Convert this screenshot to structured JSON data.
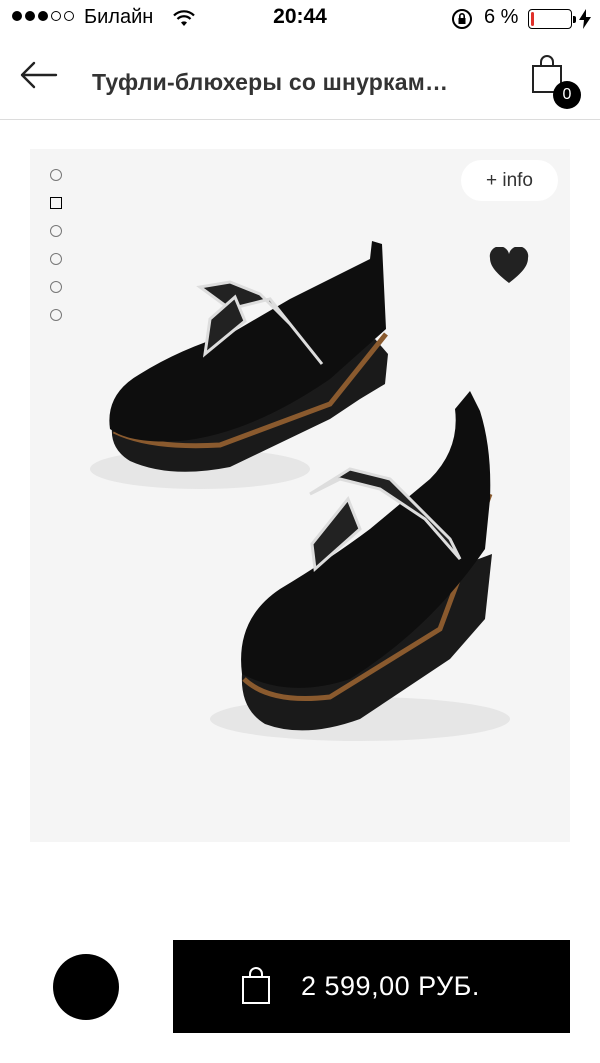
{
  "status_bar": {
    "carrier": "Билайн",
    "time": "20:44",
    "battery_percent": "6 %",
    "battery_level": 0.06,
    "signal_dots_filled": 3,
    "signal_dots_total": 5
  },
  "header": {
    "title": "Туфли-блюхеры со шнуркам…",
    "cart_count": "0"
  },
  "gallery": {
    "info_label": "+ info",
    "thumbnail_count": 6,
    "active_index": 1
  },
  "purchase": {
    "price": "2 599,00  РУБ."
  },
  "colors": {
    "accent": "#000000",
    "battery_low": "#e0312b",
    "panel_bg": "#f5f5f5"
  }
}
